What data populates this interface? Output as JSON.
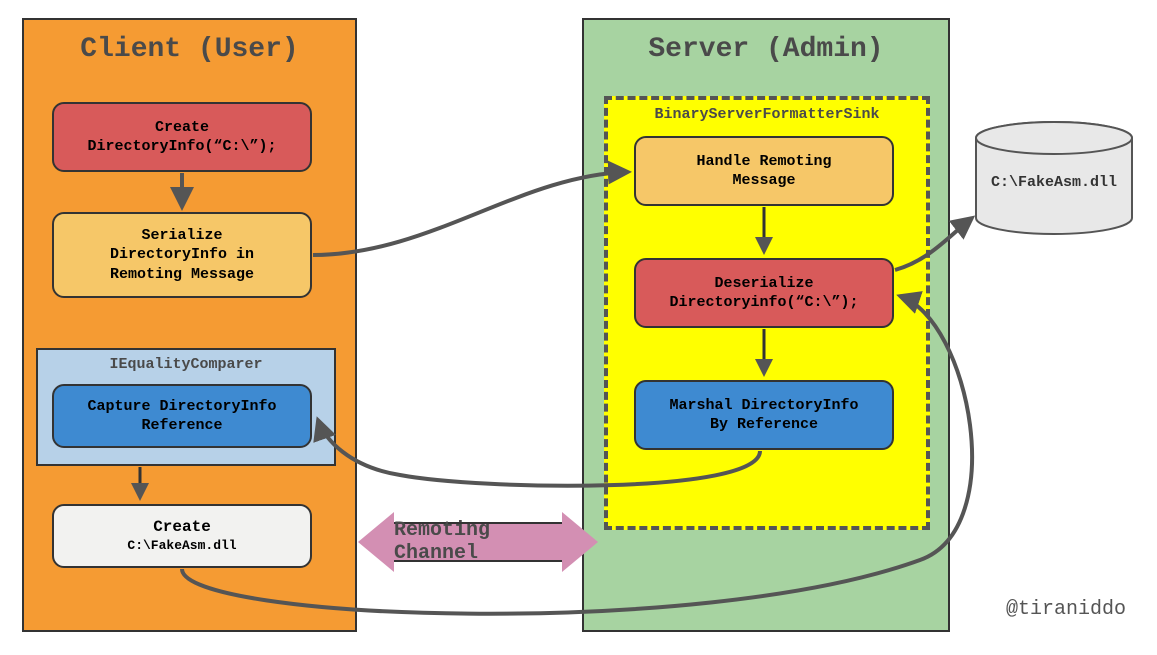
{
  "client": {
    "title": "Client (User)",
    "node1": "Create\nDirectoryInfo(“C:\\”);",
    "node2": "Serialize\nDirectoryInfo in\nRemoting Message",
    "iec_label": "IEqualityComparer",
    "node3": "Capture DirectoryInfo\nReference",
    "node4_l1": "Create",
    "node4_l2": "C:\\FakeAsm.dll"
  },
  "server": {
    "title": "Server (Admin)",
    "sink_label": "BinaryServerFormatterSink",
    "node1": "Handle Remoting\nMessage",
    "node2": "Deserialize\nDirectoryinfo(“C:\\”);",
    "node3": "Marshal DirectoryInfo\nBy Reference"
  },
  "channel": "Remoting Channel",
  "cylinder": "C:\\FakeAsm.dll",
  "credit": "@tiraniddo",
  "colors": {
    "client_bg": "#f59b33",
    "server_bg": "#a7d3a1",
    "red": "#d85a5a",
    "yellow_node": "#f6c768",
    "yellow_box": "#ffff00",
    "lightblue": "#b7d1e8",
    "blue": "#3e8ad1",
    "offwhite": "#f2f2f0",
    "pink": "#d38fb3",
    "cyl": "#e8e8e8"
  }
}
